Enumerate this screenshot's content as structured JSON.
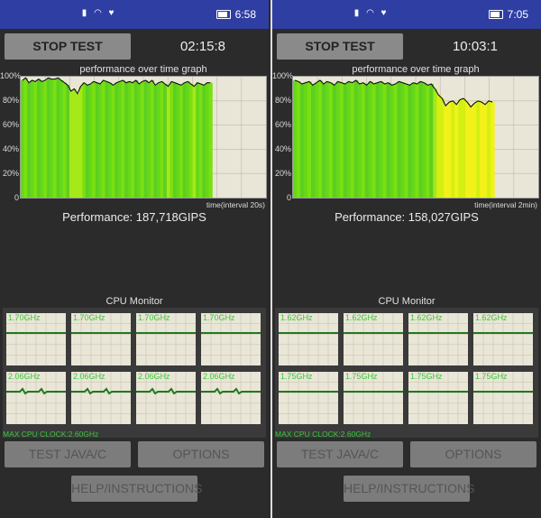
{
  "screens": [
    {
      "status_time": "6:58",
      "stop_button": "STOP TEST",
      "timer": "02:15:8",
      "graph_title": "performance over time graph",
      "y_ticks": [
        "100%",
        "80%",
        "60%",
        "40%",
        "20%",
        "0"
      ],
      "x_axis_label": "time(interval 20s)",
      "performance": "Performance: 187,718GIPS",
      "cpu_title": "CPU Monitor",
      "cpu_freqs": [
        "1.70GHz",
        "1.70GHz",
        "1.70GHz",
        "1.70GHz",
        "2.06GHz",
        "2.06GHz",
        "2.06GHz",
        "2.06GHz"
      ],
      "max_clock": "MAX CPU CLOCK:2.60GHz",
      "java_button": "TEST JAVA/C",
      "options_button": "OPTIONS",
      "help_button": "HELP/INSTRUCTIONS",
      "chart_data": {
        "type": "area",
        "ylim": [
          0,
          100
        ],
        "fill_fraction_of_width": 0.78,
        "values": [
          97,
          99,
          95,
          97,
          96,
          98,
          96,
          97,
          99,
          98,
          98,
          99,
          97,
          95,
          93,
          88,
          90,
          86,
          92,
          95,
          93,
          94,
          96,
          95,
          94,
          97,
          96,
          95,
          93,
          95,
          96,
          97,
          95,
          96,
          95,
          97,
          94,
          96,
          97,
          95,
          97,
          93,
          95,
          96,
          94,
          92,
          96,
          95,
          94,
          93,
          95,
          96,
          94,
          92,
          95,
          94,
          93,
          95,
          95
        ]
      }
    },
    {
      "status_time": "7:05",
      "stop_button": "STOP TEST",
      "timer": "10:03:1",
      "graph_title": "performance over time graph",
      "y_ticks": [
        "100%",
        "80%",
        "60%",
        "40%",
        "20%",
        "0"
      ],
      "x_axis_label": "time(interval 2min)",
      "performance": "Performance: 158,027GIPS",
      "cpu_title": "CPU Monitor",
      "cpu_freqs": [
        "1.62GHz",
        "1.62GHz",
        "1.62GHz",
        "1.62GHz",
        "1.75GHz",
        "1.75GHz",
        "1.75GHz",
        "1.75GHz"
      ],
      "max_clock": "MAX CPU CLOCK:2.60GHz",
      "java_button": "TEST JAVA/C",
      "options_button": "OPTIONS",
      "help_button": "HELP/INSTRUCTIONS",
      "chart_data": {
        "type": "area",
        "ylim": [
          0,
          100
        ],
        "fill_fraction_of_width": 0.82,
        "values": [
          97,
          96,
          94,
          95,
          96,
          93,
          95,
          97,
          94,
          96,
          95,
          93,
          96,
          95,
          94,
          96,
          95,
          97,
          94,
          95,
          93,
          96,
          94,
          95,
          96,
          94,
          95,
          93,
          94,
          96,
          95,
          94,
          93,
          95,
          94,
          96,
          95,
          93,
          94,
          90,
          85,
          82,
          76,
          79,
          80,
          77,
          81,
          82,
          79,
          75,
          78,
          80,
          79,
          77,
          80,
          79
        ]
      }
    }
  ]
}
